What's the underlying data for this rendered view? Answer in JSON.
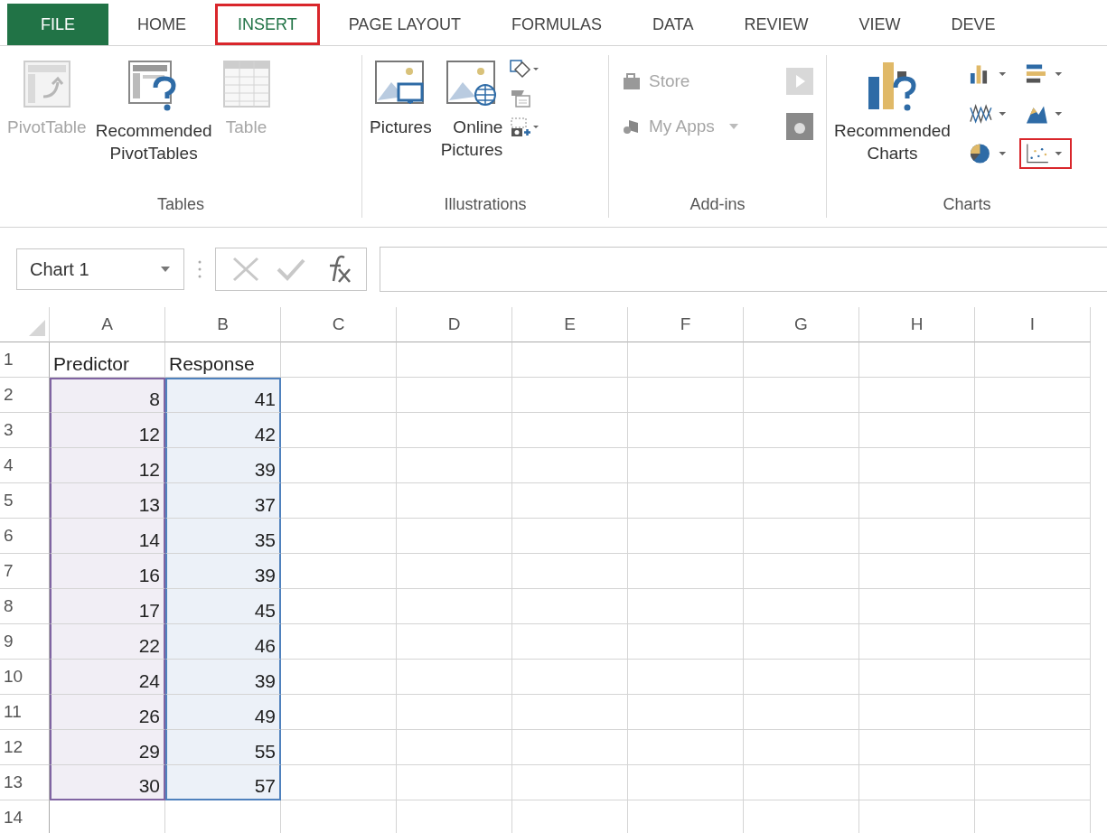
{
  "tabs": [
    {
      "label": "FILE",
      "kind": "file",
      "selected": false,
      "highlighted": false
    },
    {
      "label": "HOME",
      "kind": "tab",
      "selected": false,
      "highlighted": false
    },
    {
      "label": "INSERT",
      "kind": "tab",
      "selected": true,
      "highlighted": true
    },
    {
      "label": "PAGE LAYOUT",
      "kind": "tab",
      "selected": false,
      "highlighted": false
    },
    {
      "label": "FORMULAS",
      "kind": "tab",
      "selected": false,
      "highlighted": false
    },
    {
      "label": "DATA",
      "kind": "tab",
      "selected": false,
      "highlighted": false
    },
    {
      "label": "REVIEW",
      "kind": "tab",
      "selected": false,
      "highlighted": false
    },
    {
      "label": "VIEW",
      "kind": "tab",
      "selected": false,
      "highlighted": false
    },
    {
      "label": "DEVE",
      "kind": "tab",
      "selected": false,
      "highlighted": false
    }
  ],
  "ribbon": {
    "groups": [
      {
        "label": "Tables",
        "buttons": [
          {
            "kind": "pivottable",
            "label": "PivotTable",
            "disabled": true
          },
          {
            "kind": "recpivot",
            "label": "Recommended\nPivotTables",
            "disabled": false
          },
          {
            "kind": "table",
            "label": "Table",
            "disabled": true
          }
        ]
      },
      {
        "label": "Illustrations",
        "buttons": [
          {
            "kind": "pictures",
            "label": "Pictures",
            "disabled": false
          },
          {
            "kind": "online",
            "label": "Online\nPictures",
            "disabled": false
          }
        ],
        "small": [
          {
            "kind": "shapes"
          },
          {
            "kind": "smartart"
          },
          {
            "kind": "screenshot"
          }
        ]
      },
      {
        "label": "Add-ins",
        "addins": [
          {
            "kind": "store",
            "label": "Store",
            "disabled": true
          },
          {
            "kind": "apps",
            "label": "My Apps",
            "disabled": true
          }
        ]
      },
      {
        "label": "Charts",
        "buttons": [
          {
            "kind": "recchart",
            "label": "Recommended\nCharts",
            "disabled": false
          }
        ],
        "charts": [
          {
            "kind": "column",
            "highlighted": false
          },
          {
            "kind": "barh",
            "highlighted": false
          },
          {
            "kind": "line",
            "highlighted": false
          },
          {
            "kind": "area",
            "highlighted": false
          },
          {
            "kind": "pie",
            "highlighted": false
          },
          {
            "kind": "scatter",
            "highlighted": true
          }
        ]
      }
    ]
  },
  "formula_bar": {
    "name_box": "Chart 1"
  },
  "sheet": {
    "columns": [
      {
        "label": "A",
        "color": "#8064a2"
      },
      {
        "label": "B",
        "color": "#4f81bd"
      },
      {
        "label": "C"
      },
      {
        "label": "D"
      },
      {
        "label": "E"
      },
      {
        "label": "F"
      },
      {
        "label": "G"
      },
      {
        "label": "H"
      },
      {
        "label": "I"
      }
    ],
    "rows": [
      {
        "label": "1",
        "kind": "text",
        "in_range": false,
        "cells": [
          "Predictor",
          "Response"
        ]
      },
      {
        "label": "2",
        "kind": "number",
        "in_range": true,
        "cells": [
          "8",
          "41"
        ]
      },
      {
        "label": "3",
        "kind": "number",
        "in_range": true,
        "cells": [
          "12",
          "42"
        ]
      },
      {
        "label": "4",
        "kind": "number",
        "in_range": true,
        "cells": [
          "12",
          "39"
        ]
      },
      {
        "label": "5",
        "kind": "number",
        "in_range": true,
        "cells": [
          "13",
          "37"
        ]
      },
      {
        "label": "6",
        "kind": "number",
        "in_range": true,
        "cells": [
          "14",
          "35"
        ]
      },
      {
        "label": "7",
        "kind": "number",
        "in_range": true,
        "cells": [
          "16",
          "39"
        ]
      },
      {
        "label": "8",
        "kind": "number",
        "in_range": true,
        "cells": [
          "17",
          "45"
        ]
      },
      {
        "label": "9",
        "kind": "number",
        "in_range": true,
        "cells": [
          "22",
          "46"
        ]
      },
      {
        "label": "10",
        "kind": "number",
        "in_range": true,
        "cells": [
          "24",
          "39"
        ]
      },
      {
        "label": "11",
        "kind": "number",
        "in_range": true,
        "cells": [
          "26",
          "49"
        ]
      },
      {
        "label": "12",
        "kind": "number",
        "in_range": true,
        "cells": [
          "29",
          "55"
        ]
      },
      {
        "label": "13",
        "kind": "number",
        "in_range": true,
        "cells": [
          "30",
          "57"
        ]
      },
      {
        "label": "14",
        "kind": "number",
        "in_range": false,
        "cells": []
      }
    ]
  }
}
